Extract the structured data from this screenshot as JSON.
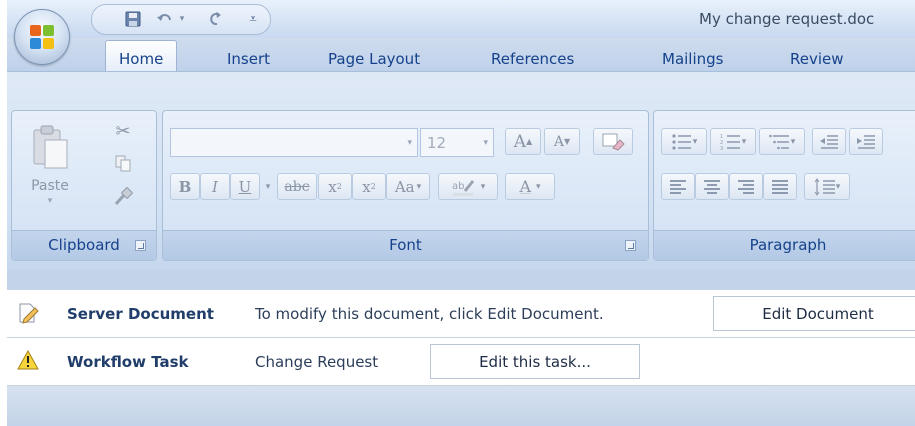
{
  "window": {
    "title": "My change request.doc"
  },
  "tabs": [
    {
      "label": "Home"
    },
    {
      "label": "Insert"
    },
    {
      "label": "Page Layout"
    },
    {
      "label": "References"
    },
    {
      "label": "Mailings"
    },
    {
      "label": "Review"
    }
  ],
  "clipboard": {
    "paste_label": "Paste",
    "group_label": "Clipboard"
  },
  "font": {
    "font_name_value": "",
    "font_size_value": "12",
    "group_label": "Font",
    "bold": "B",
    "italic": "I",
    "underline": "U",
    "strike": "abc",
    "subscript": "x",
    "superscript": "x",
    "change_case": "Aa",
    "font_color": "A",
    "grow": "A",
    "shrink": "A"
  },
  "paragraph": {
    "group_label": "Paragraph"
  },
  "server_bar": {
    "label": "Server Document",
    "message": "To modify this document, click Edit Document.",
    "button_label": "Edit Document"
  },
  "workflow_bar": {
    "label": "Workflow Task",
    "task_name": "Change Request",
    "button_label": "Edit this task..."
  },
  "colors": {
    "ribbon_text": "#15428b",
    "accent": "#c3d3e8"
  },
  "icons": [
    "office-logo-icon",
    "save-icon",
    "undo-icon",
    "redo-icon",
    "customize-qat-icon",
    "paste-icon",
    "cut-icon",
    "copy-icon",
    "format-painter-icon",
    "document-edit-icon",
    "warning-icon"
  ]
}
